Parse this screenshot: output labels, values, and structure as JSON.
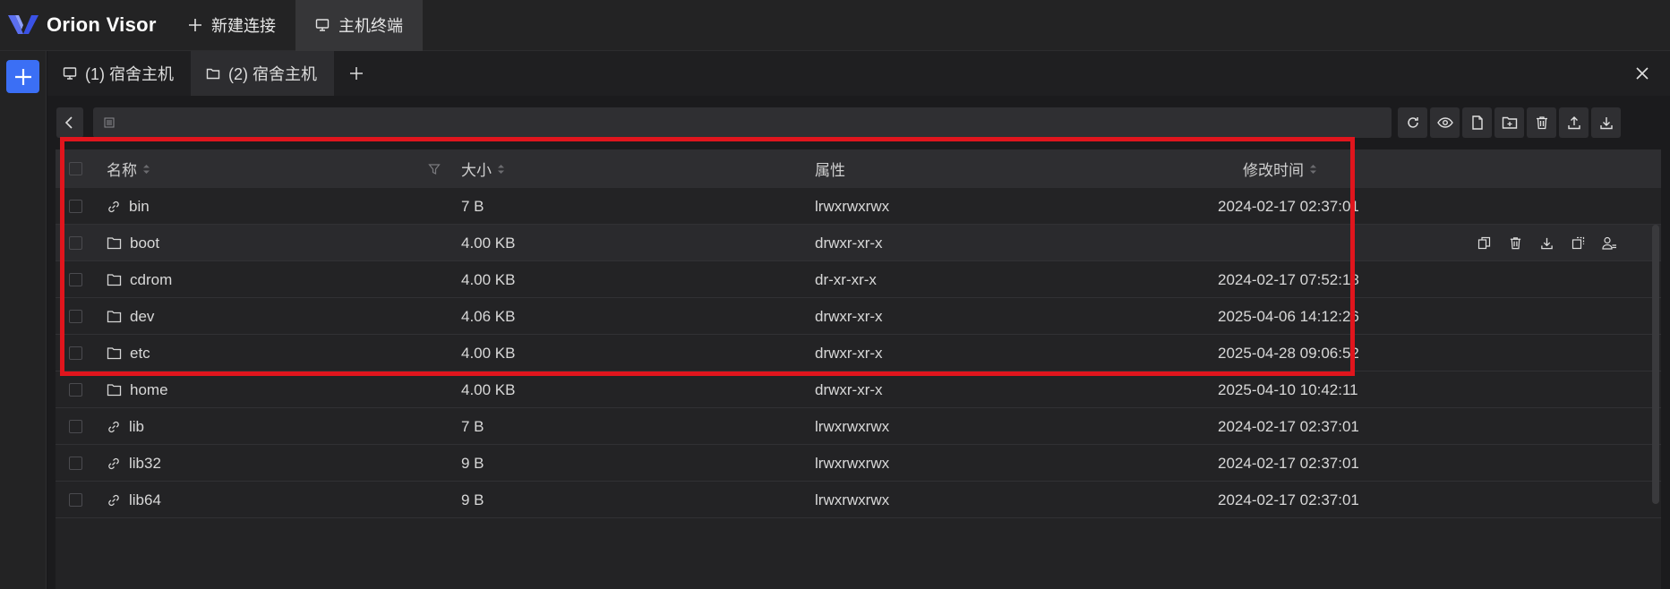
{
  "app": {
    "name": "Orion Visor",
    "top_tabs": [
      {
        "label": "新建连接",
        "icon": "plus-icon"
      },
      {
        "label": "主机终端",
        "icon": "monitor-icon",
        "active": true
      }
    ]
  },
  "host_tabs": [
    {
      "label": "(1) 宿舍主机",
      "icon": "monitor-icon"
    },
    {
      "label": "(2) 宿舍主机",
      "icon": "folder-icon",
      "active": true
    }
  ],
  "path_bar": {
    "value": ""
  },
  "toolbar_icons": [
    "refresh-icon",
    "eye-icon",
    "new-file-icon",
    "new-folder-icon",
    "delete-icon",
    "upload-icon",
    "download-icon"
  ],
  "table": {
    "columns": {
      "name": "名称",
      "size": "大小",
      "attr": "属性",
      "modified": "修改时间"
    },
    "rows": [
      {
        "type": "link",
        "name": "bin",
        "size": "7 B",
        "attr": "lrwxrwxrwx",
        "modified": "2024-02-17 02:37:01"
      },
      {
        "type": "folder",
        "name": "boot",
        "size": "4.00 KB",
        "attr": "drwxr-xr-x",
        "modified": "",
        "hover": true
      },
      {
        "type": "folder",
        "name": "cdrom",
        "size": "4.00 KB",
        "attr": "dr-xr-xr-x",
        "modified": "2024-02-17 07:52:18"
      },
      {
        "type": "folder",
        "name": "dev",
        "size": "4.06 KB",
        "attr": "drwxr-xr-x",
        "modified": "2025-04-06 14:12:26"
      },
      {
        "type": "folder",
        "name": "etc",
        "size": "4.00 KB",
        "attr": "drwxr-xr-x",
        "modified": "2025-04-28 09:06:52"
      },
      {
        "type": "folder",
        "name": "home",
        "size": "4.00 KB",
        "attr": "drwxr-xr-x",
        "modified": "2025-04-10 10:42:11"
      },
      {
        "type": "link",
        "name": "lib",
        "size": "7 B",
        "attr": "lrwxrwxrwx",
        "modified": "2024-02-17 02:37:01"
      },
      {
        "type": "link",
        "name": "lib32",
        "size": "9 B",
        "attr": "lrwxrwxrwx",
        "modified": "2024-02-17 02:37:01"
      },
      {
        "type": "link",
        "name": "lib64",
        "size": "9 B",
        "attr": "lrwxrwxrwx",
        "modified": "2024-02-17 02:37:01"
      }
    ],
    "row_action_icons": [
      "copy-icon",
      "delete-icon",
      "download-icon",
      "move-icon",
      "owner-icon"
    ]
  },
  "colors": {
    "accent": "#3b6ff5",
    "highlight": "#e0151d",
    "background": "#1b1b1d"
  }
}
